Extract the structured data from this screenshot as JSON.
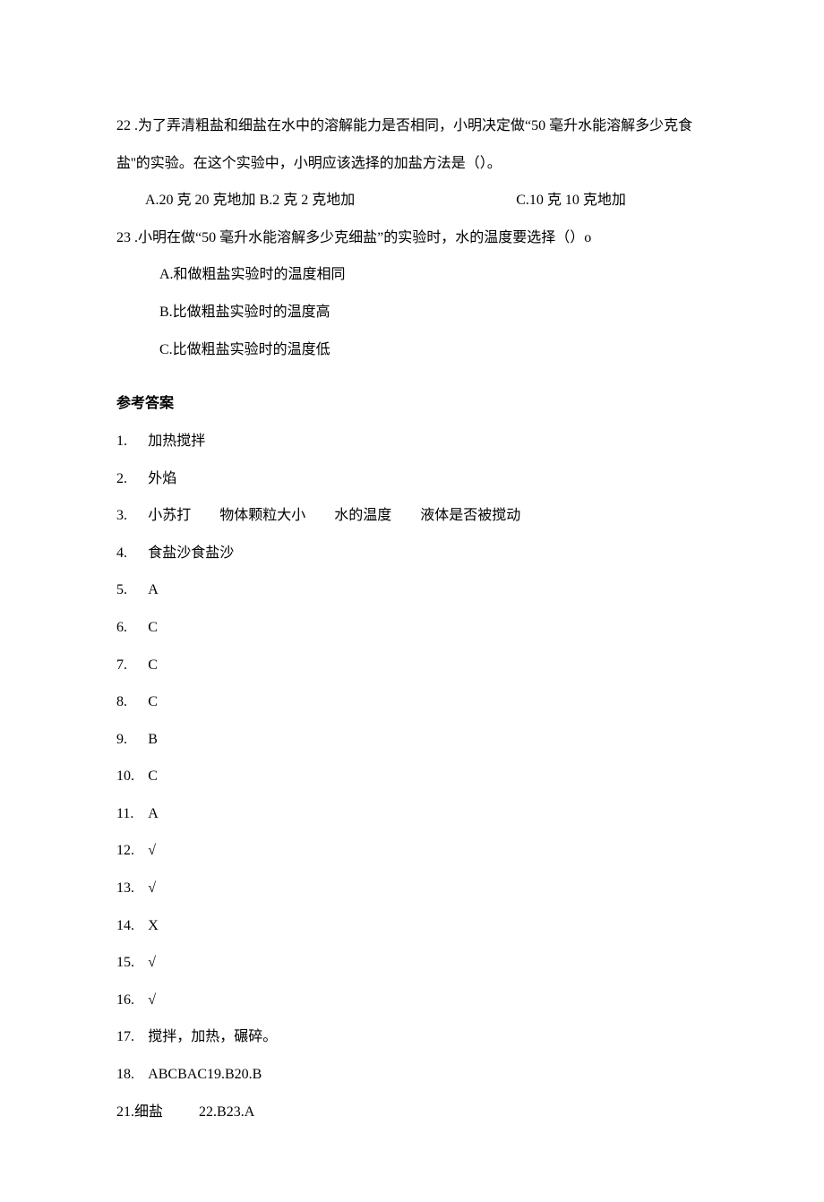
{
  "q22": {
    "num": "22",
    "text_line1": " .为了弄清粗盐和细盐在水中的溶解能力是否相同，小明决定做“50 毫升水能溶解多少克食",
    "text_line2": "盐''的实验。在这个实验中，小明应该选择的加盐方法是（）。",
    "optA": "A.20 克 20 克地加",
    "optB": "B.2 克 2 克地加",
    "optC": "C.10 克 10 克地加"
  },
  "q23": {
    "num": "23",
    "text": " .小明在做“50 毫升水能溶解多少克细盐”的实验时，水的温度要选择（）o",
    "optA": "A.和做粗盐实验时的温度相同",
    "optB": "B.比做粗盐实验时的温度高",
    "optC": "C.比做粗盐实验时的温度低"
  },
  "answers_title": "参考答案",
  "answers": {
    "a1": {
      "num": "1. ",
      "val": "加热搅拌"
    },
    "a2": {
      "num": "2. ",
      "val": "外焰"
    },
    "a3": {
      "num": "3. ",
      "parts": [
        "小苏打",
        "物体颗粒大小",
        "水的温度",
        "液体是否被搅动"
      ]
    },
    "a4": {
      "num": "4. ",
      "val": "食盐沙食盐沙"
    },
    "a5": {
      "num": "5. ",
      "val": "A"
    },
    "a6": {
      "num": "6. ",
      "val": "C"
    },
    "a7": {
      "num": "7. ",
      "val": "C"
    },
    "a8": {
      "num": "8. ",
      "val": "C"
    },
    "a9": {
      "num": "9. ",
      "val": "B"
    },
    "a10": {
      "num": "10. ",
      "val": "C"
    },
    "a11": {
      "num": "11. ",
      "val": "A"
    },
    "a12": {
      "num": "12. ",
      "val": "√"
    },
    "a13": {
      "num": "13. ",
      "val": "√"
    },
    "a14": {
      "num": "14. ",
      "val": "X"
    },
    "a15": {
      "num": "15. ",
      "val": "√"
    },
    "a16": {
      "num": "16. ",
      "val": "√"
    },
    "a17": {
      "num": "17. ",
      "val": "搅拌，加热，碾碎。"
    },
    "a18": {
      "num": "18. ",
      "val": "ABCBAC19.B20.B"
    },
    "a21": {
      "prefix": "21.细盐",
      "rest": "22.B23.A"
    }
  }
}
